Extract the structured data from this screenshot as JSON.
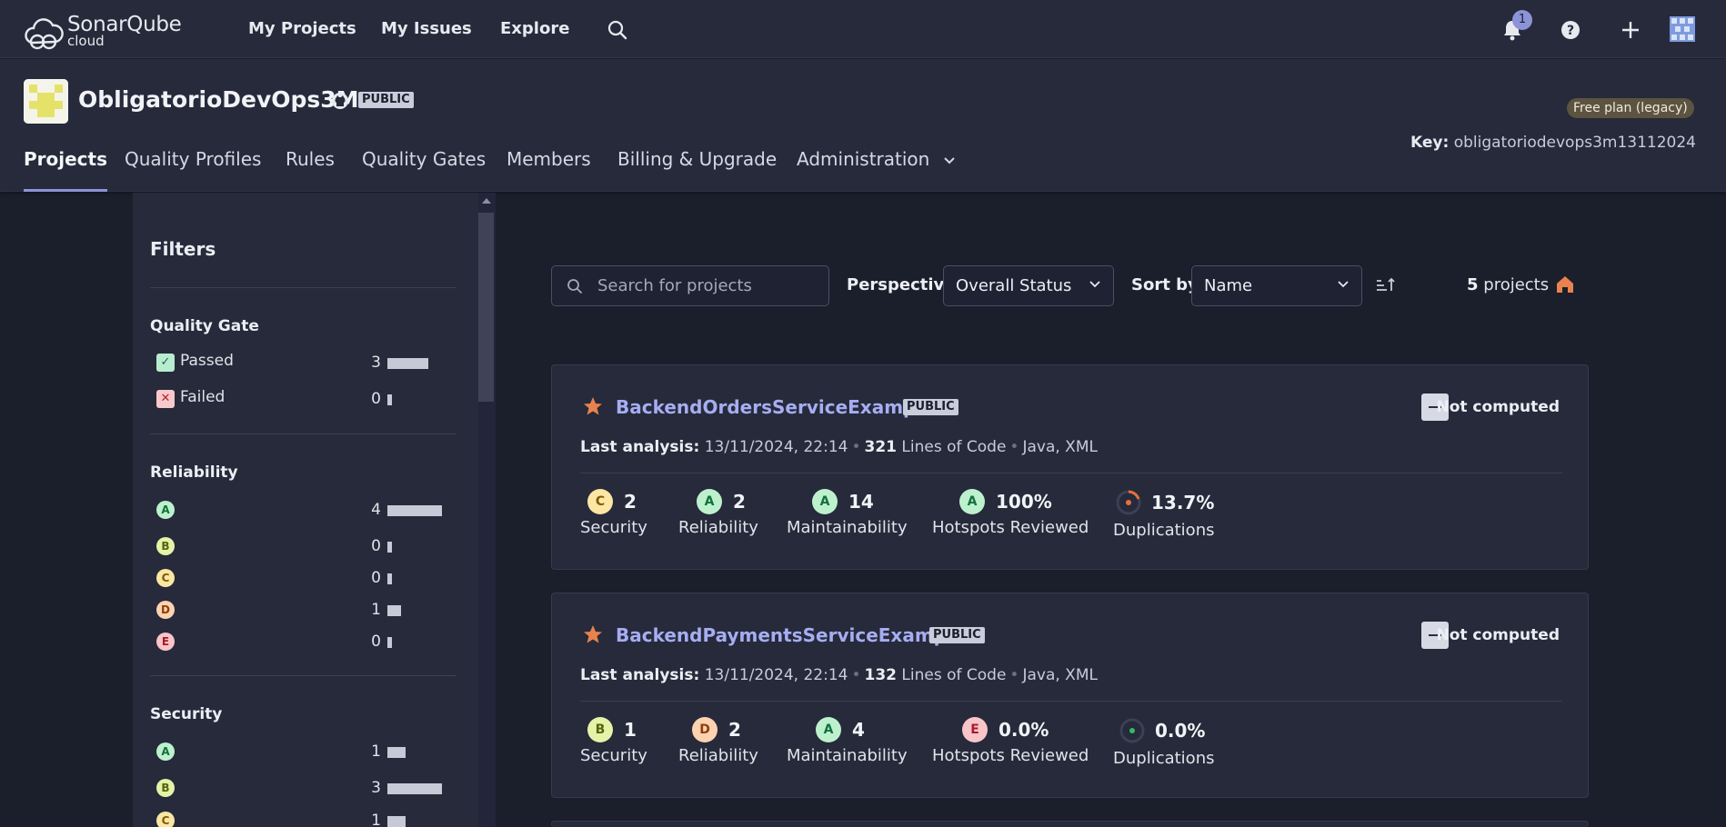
{
  "topbar": {
    "logo_line1": "SonarQube",
    "logo_line2": "cloud",
    "nav": [
      "My Projects",
      "My Issues",
      "Explore"
    ],
    "notification_count": "1",
    "icons": [
      "search-icon",
      "bell-icon",
      "help-icon",
      "plus-icon",
      "user-avatar"
    ]
  },
  "org": {
    "name": "ObligatorioDevOps3M",
    "visibility": "PUBLIC",
    "plan": "Free plan (legacy)",
    "key_label": "Key:",
    "key_value": "obligatoriodevops3m13112024",
    "tabs": [
      "Projects",
      "Quality Profiles",
      "Rules",
      "Quality Gates",
      "Members",
      "Billing & Upgrade",
      "Administration"
    ],
    "active_tab": "Projects"
  },
  "filters": {
    "title": "Filters",
    "quality_gate": {
      "title": "Quality Gate",
      "items": [
        {
          "label": "Passed",
          "count": "3",
          "fraction": 0.75
        },
        {
          "label": "Failed",
          "count": "0",
          "fraction": 0.0
        }
      ]
    },
    "reliability": {
      "title": "Reliability",
      "items": [
        {
          "rating": "A",
          "count": "4",
          "fraction": 1.0
        },
        {
          "rating": "B",
          "count": "0",
          "fraction": 0.0
        },
        {
          "rating": "C",
          "count": "0",
          "fraction": 0.0
        },
        {
          "rating": "D",
          "count": "1",
          "fraction": 0.25
        },
        {
          "rating": "E",
          "count": "0",
          "fraction": 0.0
        }
      ]
    },
    "security": {
      "title": "Security",
      "items": [
        {
          "rating": "A",
          "count": "1",
          "fraction": 0.33
        },
        {
          "rating": "B",
          "count": "3",
          "fraction": 1.0
        },
        {
          "rating": "C",
          "count": "1",
          "fraction": 0.33
        }
      ]
    }
  },
  "toolbar": {
    "search_placeholder": "Search for projects",
    "perspective_label": "Perspective",
    "perspective_value": "Overall Status",
    "sort_label": "Sort by",
    "sort_value": "Name",
    "project_count": "5",
    "project_count_suffix": "projects"
  },
  "projects": [
    {
      "name": "BackendOrdersServiceExample",
      "visibility": "PUBLIC",
      "status": "Not computed",
      "last_analysis_label": "Last analysis:",
      "last_analysis": "13/11/2024, 22:14",
      "loc": "321",
      "loc_label": "Lines of Code",
      "languages": "Java, XML",
      "metrics": [
        {
          "rating": "C",
          "value": "2",
          "label": "Security"
        },
        {
          "rating": "A",
          "value": "2",
          "label": "Reliability"
        },
        {
          "rating": "A",
          "value": "14",
          "label": "Maintainability"
        },
        {
          "rating": "A",
          "value": "100%",
          "label": "Hotspots Reviewed"
        }
      ],
      "duplications": {
        "value": "13.7%",
        "label": "Duplications",
        "color": "#e8703a"
      }
    },
    {
      "name": "BackendPaymentsServiceExample",
      "visibility": "PUBLIC",
      "status": "Not computed",
      "last_analysis_label": "Last analysis:",
      "last_analysis": "13/11/2024, 22:14",
      "loc": "132",
      "loc_label": "Lines of Code",
      "languages": "Java, XML",
      "metrics": [
        {
          "rating": "B",
          "value": "1",
          "label": "Security"
        },
        {
          "rating": "D",
          "value": "2",
          "label": "Reliability"
        },
        {
          "rating": "A",
          "value": "4",
          "label": "Maintainability"
        },
        {
          "rating": "E",
          "value": "0.0%",
          "label": "Hotspots Reviewed"
        }
      ],
      "duplications": {
        "value": "0.0%",
        "label": "Duplications",
        "color": "#2fbb6c"
      }
    }
  ],
  "colors": {
    "accent": "#8c94d7",
    "link": "#a6adf2",
    "star": "#e8824f"
  }
}
